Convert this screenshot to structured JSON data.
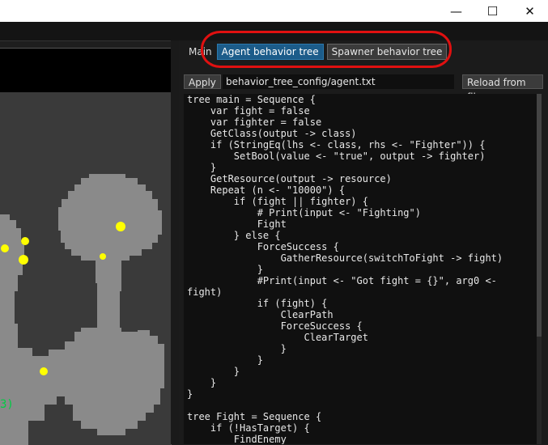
{
  "window": {
    "minimize_glyph": "—",
    "maximize_glyph": "☐",
    "close_glyph": "✕"
  },
  "tabs": {
    "main": "Main",
    "agent": "Agent behavior tree",
    "spawner": "Spawner behavior tree"
  },
  "toolbar": {
    "apply": "Apply",
    "path": "behavior_tree_config/agent.txt",
    "reload": "Reload from file"
  },
  "viewport": {
    "label_fragment": "3)"
  },
  "editor": {
    "code": "tree main = Sequence {\n    var fight = false\n    var fighter = false\n    GetClass(output -> class)\n    if (StringEq(lhs <- class, rhs <- \"Fighter\")) {\n        SetBool(value <- \"true\", output -> fighter)\n    }\n    GetResource(output -> resource)\n    Repeat (n <- \"10000\") {\n        if (fight || fighter) {\n            # Print(input <- \"Fighting\")\n            Fight\n        } else {\n            ForceSuccess {\n                GatherResource(switchToFight -> fight)\n            }\n            #Print(input <- \"Got fight = {}\", arg0 <-\nfight)\n            if (fight) {\n                ClearPath\n                ForceSuccess {\n                    ClearTarget\n                }\n            }\n        }\n    }\n}\n\ntree Fight = Sequence {\n    if (!HasTarget) {\n        FindEnemy"
  },
  "colors": {
    "active_tab": "#1c5c8a",
    "highlight": "#e01010",
    "agent": "#ffff00",
    "label": "#00cc44"
  }
}
